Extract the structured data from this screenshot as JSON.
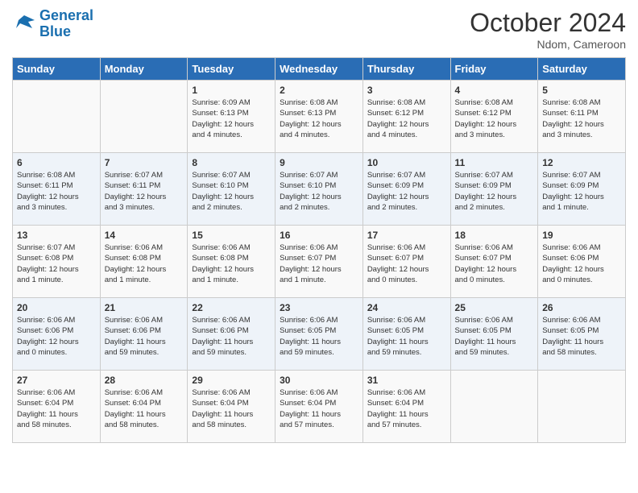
{
  "logo": {
    "line1": "General",
    "line2": "Blue"
  },
  "title": "October 2024",
  "location": "Ndom, Cameroon",
  "days_of_week": [
    "Sunday",
    "Monday",
    "Tuesday",
    "Wednesday",
    "Thursday",
    "Friday",
    "Saturday"
  ],
  "weeks": [
    [
      {
        "day": "",
        "info": ""
      },
      {
        "day": "",
        "info": ""
      },
      {
        "day": "1",
        "info": "Sunrise: 6:09 AM\nSunset: 6:13 PM\nDaylight: 12 hours\nand 4 minutes."
      },
      {
        "day": "2",
        "info": "Sunrise: 6:08 AM\nSunset: 6:13 PM\nDaylight: 12 hours\nand 4 minutes."
      },
      {
        "day": "3",
        "info": "Sunrise: 6:08 AM\nSunset: 6:12 PM\nDaylight: 12 hours\nand 4 minutes."
      },
      {
        "day": "4",
        "info": "Sunrise: 6:08 AM\nSunset: 6:12 PM\nDaylight: 12 hours\nand 3 minutes."
      },
      {
        "day": "5",
        "info": "Sunrise: 6:08 AM\nSunset: 6:11 PM\nDaylight: 12 hours\nand 3 minutes."
      }
    ],
    [
      {
        "day": "6",
        "info": "Sunrise: 6:08 AM\nSunset: 6:11 PM\nDaylight: 12 hours\nand 3 minutes."
      },
      {
        "day": "7",
        "info": "Sunrise: 6:07 AM\nSunset: 6:11 PM\nDaylight: 12 hours\nand 3 minutes."
      },
      {
        "day": "8",
        "info": "Sunrise: 6:07 AM\nSunset: 6:10 PM\nDaylight: 12 hours\nand 2 minutes."
      },
      {
        "day": "9",
        "info": "Sunrise: 6:07 AM\nSunset: 6:10 PM\nDaylight: 12 hours\nand 2 minutes."
      },
      {
        "day": "10",
        "info": "Sunrise: 6:07 AM\nSunset: 6:09 PM\nDaylight: 12 hours\nand 2 minutes."
      },
      {
        "day": "11",
        "info": "Sunrise: 6:07 AM\nSunset: 6:09 PM\nDaylight: 12 hours\nand 2 minutes."
      },
      {
        "day": "12",
        "info": "Sunrise: 6:07 AM\nSunset: 6:09 PM\nDaylight: 12 hours\nand 1 minute."
      }
    ],
    [
      {
        "day": "13",
        "info": "Sunrise: 6:07 AM\nSunset: 6:08 PM\nDaylight: 12 hours\nand 1 minute."
      },
      {
        "day": "14",
        "info": "Sunrise: 6:06 AM\nSunset: 6:08 PM\nDaylight: 12 hours\nand 1 minute."
      },
      {
        "day": "15",
        "info": "Sunrise: 6:06 AM\nSunset: 6:08 PM\nDaylight: 12 hours\nand 1 minute."
      },
      {
        "day": "16",
        "info": "Sunrise: 6:06 AM\nSunset: 6:07 PM\nDaylight: 12 hours\nand 1 minute."
      },
      {
        "day": "17",
        "info": "Sunrise: 6:06 AM\nSunset: 6:07 PM\nDaylight: 12 hours\nand 0 minutes."
      },
      {
        "day": "18",
        "info": "Sunrise: 6:06 AM\nSunset: 6:07 PM\nDaylight: 12 hours\nand 0 minutes."
      },
      {
        "day": "19",
        "info": "Sunrise: 6:06 AM\nSunset: 6:06 PM\nDaylight: 12 hours\nand 0 minutes."
      }
    ],
    [
      {
        "day": "20",
        "info": "Sunrise: 6:06 AM\nSunset: 6:06 PM\nDaylight: 12 hours\nand 0 minutes."
      },
      {
        "day": "21",
        "info": "Sunrise: 6:06 AM\nSunset: 6:06 PM\nDaylight: 11 hours\nand 59 minutes."
      },
      {
        "day": "22",
        "info": "Sunrise: 6:06 AM\nSunset: 6:06 PM\nDaylight: 11 hours\nand 59 minutes."
      },
      {
        "day": "23",
        "info": "Sunrise: 6:06 AM\nSunset: 6:05 PM\nDaylight: 11 hours\nand 59 minutes."
      },
      {
        "day": "24",
        "info": "Sunrise: 6:06 AM\nSunset: 6:05 PM\nDaylight: 11 hours\nand 59 minutes."
      },
      {
        "day": "25",
        "info": "Sunrise: 6:06 AM\nSunset: 6:05 PM\nDaylight: 11 hours\nand 59 minutes."
      },
      {
        "day": "26",
        "info": "Sunrise: 6:06 AM\nSunset: 6:05 PM\nDaylight: 11 hours\nand 58 minutes."
      }
    ],
    [
      {
        "day": "27",
        "info": "Sunrise: 6:06 AM\nSunset: 6:04 PM\nDaylight: 11 hours\nand 58 minutes."
      },
      {
        "day": "28",
        "info": "Sunrise: 6:06 AM\nSunset: 6:04 PM\nDaylight: 11 hours\nand 58 minutes."
      },
      {
        "day": "29",
        "info": "Sunrise: 6:06 AM\nSunset: 6:04 PM\nDaylight: 11 hours\nand 58 minutes."
      },
      {
        "day": "30",
        "info": "Sunrise: 6:06 AM\nSunset: 6:04 PM\nDaylight: 11 hours\nand 57 minutes."
      },
      {
        "day": "31",
        "info": "Sunrise: 6:06 AM\nSunset: 6:04 PM\nDaylight: 11 hours\nand 57 minutes."
      },
      {
        "day": "",
        "info": ""
      },
      {
        "day": "",
        "info": ""
      }
    ]
  ]
}
